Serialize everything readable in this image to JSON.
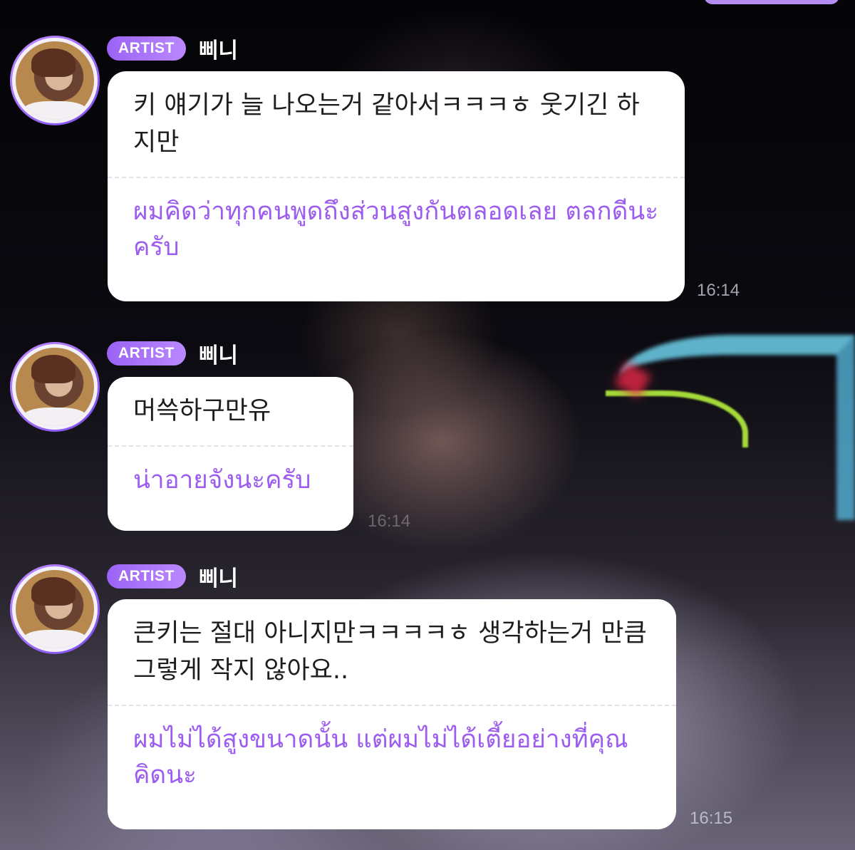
{
  "messages": [
    {
      "badge": "ARTIST",
      "name": "삐니",
      "korean": "키 얘기가 늘 나오는거 같아서ㅋㅋㅋㅎ 웃기긴 하지만",
      "thai": "ผมคิดว่าทุกคนพูดถึงส่วนสูงกันตลอดเลย ตลกดีนะครับ",
      "time": "16:14"
    },
    {
      "badge": "ARTIST",
      "name": "삐니",
      "korean": "머쓱하구만유",
      "thai": "น่าอายจังนะครับ",
      "time": "16:14"
    },
    {
      "badge": "ARTIST",
      "name": "삐니",
      "korean": "큰키는 절대 아니지만ㅋㅋㅋㅋㅎ 생각하는거 만큼 그렇게 작지 않아요..",
      "thai": "ผมไม่ได้สูงขนาดนั้น แต่ผมไม่ได้เตี้ยอย่างที่คุณคิดนะ",
      "time": "16:15"
    }
  ],
  "colors": {
    "accent": "#9c5cf0",
    "badge": "#a56ef7",
    "bubble": "#ffffff"
  },
  "icons": {
    "avatar": "artist-profile-photo"
  }
}
